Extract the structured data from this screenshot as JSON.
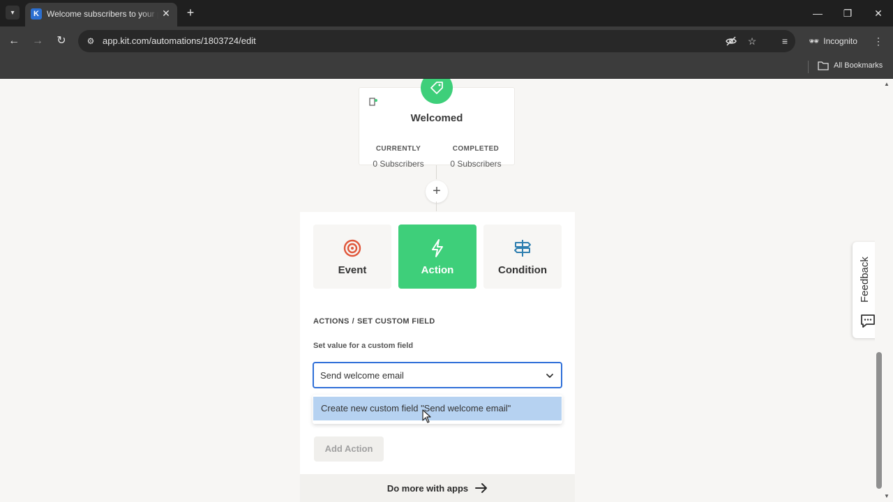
{
  "browser": {
    "tab_title": "Welcome subscribers to your p",
    "tab_favicon_letter": "K",
    "url": "app.kit.com/automations/1803724/edit",
    "incognito_label": "Incognito",
    "bookmarks_label": "All Bookmarks"
  },
  "node": {
    "title": "Welcomed",
    "currently_label": "CURRENTLY",
    "currently_value": "0 Subscribers",
    "completed_label": "COMPLETED",
    "completed_value": "0 Subscribers",
    "badge_icon": "tag-icon"
  },
  "add_step_icon": "plus-icon",
  "step_types": [
    {
      "label": "Event",
      "icon": "target-icon",
      "color": "#e0563a",
      "active": false
    },
    {
      "label": "Action",
      "icon": "lightning-icon",
      "color": "#ffffff",
      "active": true
    },
    {
      "label": "Condition",
      "icon": "signpost-icon",
      "color": "#2f7fb0",
      "active": false
    }
  ],
  "breadcrumb": {
    "parent": "ACTIONS",
    "separator": "/",
    "current": "SET CUSTOM FIELD"
  },
  "custom_field": {
    "label": "Set value for a custom field",
    "input_value": "Send welcome email",
    "option": "Create new custom field \"Send welcome email\""
  },
  "add_action_label": "Add Action",
  "more_apps_label": "Do more with apps",
  "feedback_label": "Feedback",
  "colors": {
    "accent_green": "#3ecf7a",
    "focus_blue": "#2f6fd8",
    "option_highlight": "#b6d2f1"
  }
}
